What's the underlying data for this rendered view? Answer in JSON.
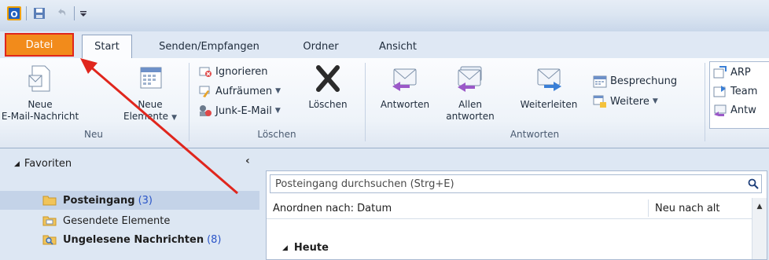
{
  "tabs": {
    "datei": "Datei",
    "start": "Start",
    "senden": "Senden/Empfangen",
    "ordner": "Ordner",
    "ansicht": "Ansicht"
  },
  "ribbon": {
    "neu": {
      "neue_email_line1": "Neue",
      "neue_email_line2": "E-Mail-Nachricht",
      "neue_elemente_line1": "Neue",
      "neue_elemente_line2": "Elemente",
      "group_label": "Neu"
    },
    "loeschen": {
      "ignorieren": "Ignorieren",
      "aufraeumen": "Aufräumen",
      "junk": "Junk-E-Mail",
      "loeschen_btn": "Löschen",
      "group_label": "Löschen"
    },
    "antworten": {
      "antworten_btn": "Antworten",
      "allen_line1": "Allen",
      "allen_line2": "antworten",
      "weiterleiten": "Weiterleiten",
      "besprechung": "Besprechung",
      "weitere": "Weitere",
      "group_label": "Antworten"
    },
    "quicksteps": {
      "item1": "ARP",
      "item2": "Team",
      "item3": "Antw"
    }
  },
  "nav": {
    "favoriten": "Favoriten",
    "folders": [
      {
        "name": "Posteingang",
        "count": "(3)"
      },
      {
        "name": "Gesendete Elemente",
        "count": ""
      },
      {
        "name": "Ungelesene Nachrichten",
        "count": "(8)"
      }
    ]
  },
  "list": {
    "search_placeholder": "Posteingang durchsuchen (Strg+E)",
    "sort_label": "Anordnen nach: Datum",
    "order_label": "Neu nach alt",
    "group_heute": "Heute"
  },
  "colors": {
    "datei_tab": "#f28b1b",
    "highlight_border": "#e0261d",
    "annotation_arrow": "#e0261d",
    "count_blue": "#2a55c8"
  }
}
